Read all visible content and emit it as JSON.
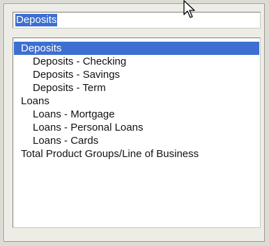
{
  "combo": {
    "value": "Deposits"
  },
  "list": {
    "items": [
      {
        "label": "Deposits",
        "level": 0,
        "selected": true
      },
      {
        "label": "Deposits - Checking",
        "level": 1,
        "selected": false
      },
      {
        "label": "Deposits - Savings",
        "level": 1,
        "selected": false
      },
      {
        "label": "Deposits - Term",
        "level": 1,
        "selected": false
      },
      {
        "label": "Loans",
        "level": 0,
        "selected": false
      },
      {
        "label": "Loans - Mortgage",
        "level": 1,
        "selected": false
      },
      {
        "label": "Loans - Personal Loans",
        "level": 1,
        "selected": false
      },
      {
        "label": "Loans - Cards",
        "level": 1,
        "selected": false
      },
      {
        "label": "Total Product Groups/Line of Business",
        "level": 0,
        "selected": false
      }
    ]
  },
  "colors": {
    "selection": "#3d6fd0",
    "panel": "#ededE6"
  },
  "icons": {
    "cursor": "mouse-pointer-icon"
  }
}
